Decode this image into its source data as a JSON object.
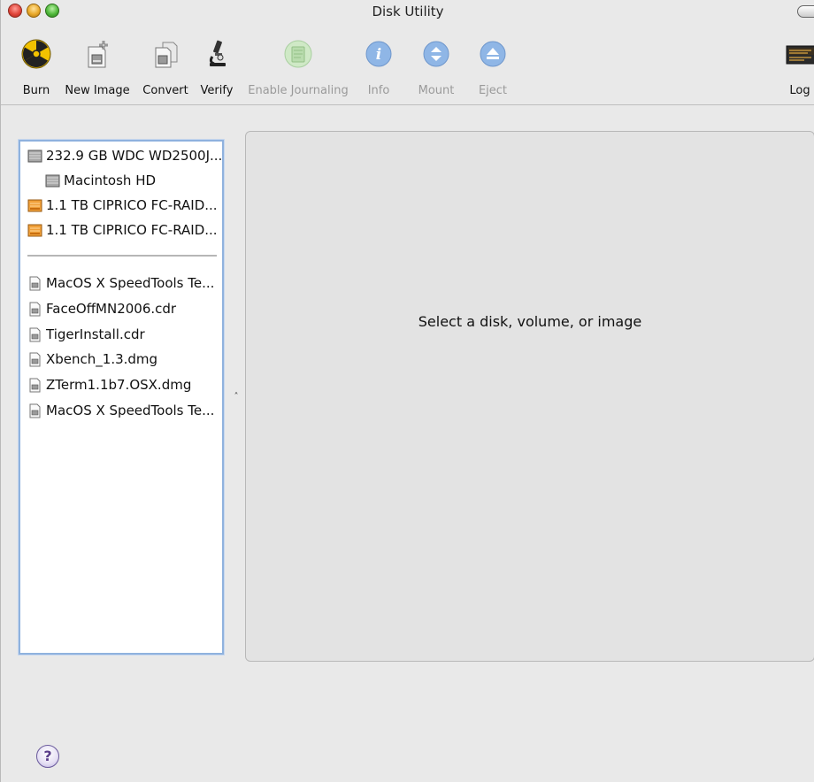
{
  "window": {
    "title": "Disk Utility"
  },
  "toolbar": {
    "items": [
      {
        "label": "Burn",
        "icon": "burn-icon",
        "enabled": true
      },
      {
        "label": "New Image",
        "icon": "new-image-icon",
        "enabled": true
      },
      {
        "label": "Convert",
        "icon": "convert-icon",
        "enabled": true
      },
      {
        "label": "Verify",
        "icon": "verify-microscope-icon",
        "enabled": true
      },
      {
        "label": "Enable Journaling",
        "icon": "enable-journaling-icon",
        "enabled": false
      },
      {
        "label": "Info",
        "icon": "info-icon",
        "enabled": false
      },
      {
        "label": "Mount",
        "icon": "mount-icon",
        "enabled": false
      },
      {
        "label": "Eject",
        "icon": "eject-icon",
        "enabled": false
      },
      {
        "label": "Log",
        "icon": "log-icon",
        "enabled": true
      }
    ]
  },
  "sidebar": {
    "disks": [
      {
        "label": "232.9 GB WDC WD2500J...",
        "icon": "internal-disk-icon",
        "indent": false
      },
      {
        "label": "Macintosh HD",
        "icon": "volume-icon",
        "indent": true
      },
      {
        "label": "1.1 TB CIPRICO FC-RAID...",
        "icon": "external-disk-icon",
        "indent": false
      },
      {
        "label": "1.1 TB CIPRICO FC-RAID...",
        "icon": "external-disk-icon",
        "indent": false
      }
    ],
    "images": [
      {
        "label": "MacOS X SpeedTools Te...",
        "icon": "disk-image-icon"
      },
      {
        "label": "FaceOffMN2006.cdr",
        "icon": "disk-image-icon"
      },
      {
        "label": "TigerInstall.cdr",
        "icon": "disk-image-icon"
      },
      {
        "label": "Xbench_1.3.dmg",
        "icon": "disk-image-icon"
      },
      {
        "label": "ZTerm1.1b7.OSX.dmg",
        "icon": "disk-image-icon"
      },
      {
        "label": "MacOS X SpeedTools Te...",
        "icon": "disk-image-icon"
      }
    ]
  },
  "detail": {
    "message": "Select a disk, volume, or image"
  },
  "help": {
    "label": "?"
  },
  "colors": {
    "selection_border": "#8fb2de",
    "disabled_text": "#9a9a9a"
  }
}
